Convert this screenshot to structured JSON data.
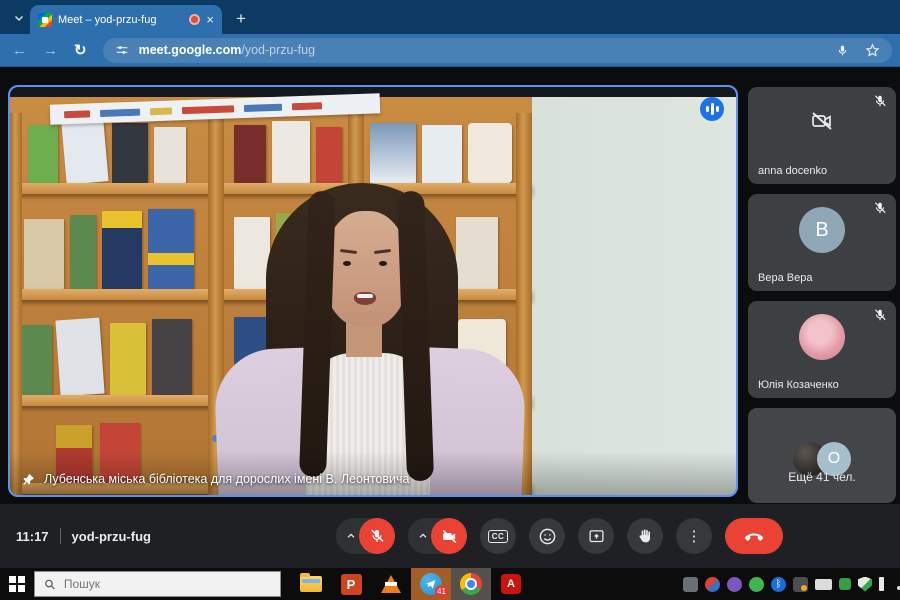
{
  "browser": {
    "tab": {
      "title": "Meet – yod-przu-fug",
      "close_glyph": "×",
      "new_tab_glyph": "+"
    },
    "url": {
      "host": "meet.google.com",
      "path": "/yod-przu-fug"
    }
  },
  "meet": {
    "pinned_caption": "Лубенська міська бібліотека для дорослих імені В. Леонтовича",
    "time": "11:17",
    "meeting_code": "yod-przu-fug",
    "participants": [
      {
        "name": "anna docenko",
        "muted": true,
        "camera_off": true
      },
      {
        "name": "Вера Вера",
        "muted": true,
        "avatar_letter": "В"
      },
      {
        "name": "Юлія Козаченко",
        "muted": true,
        "avatar": "photo"
      },
      {
        "name": "Ещё 41 чел.",
        "overflow": true,
        "avatar_letter": "О"
      }
    ],
    "controls": [
      "mic-off",
      "camera-off",
      "captions",
      "reactions",
      "present",
      "raise-hand",
      "more-options",
      "end-call"
    ],
    "icons": {
      "cc_label": "CC",
      "more_glyph": "⋮"
    }
  },
  "taskbar": {
    "search_placeholder": "Пошук",
    "telegram_badge": "41",
    "powerpoint_glyph": "P",
    "acrobat_glyph": "A",
    "apps": [
      "file-explorer",
      "powerpoint",
      "vlc",
      "telegram",
      "chrome",
      "acrobat-reader"
    ]
  },
  "colors": {
    "accent_blue": "#1a73e8",
    "danger_red": "#ea4335",
    "theme_navy": "#0d3a63",
    "theme_blue": "#2e6fad",
    "tile_gray": "#3c4043",
    "video_border": "#5b92f2"
  }
}
